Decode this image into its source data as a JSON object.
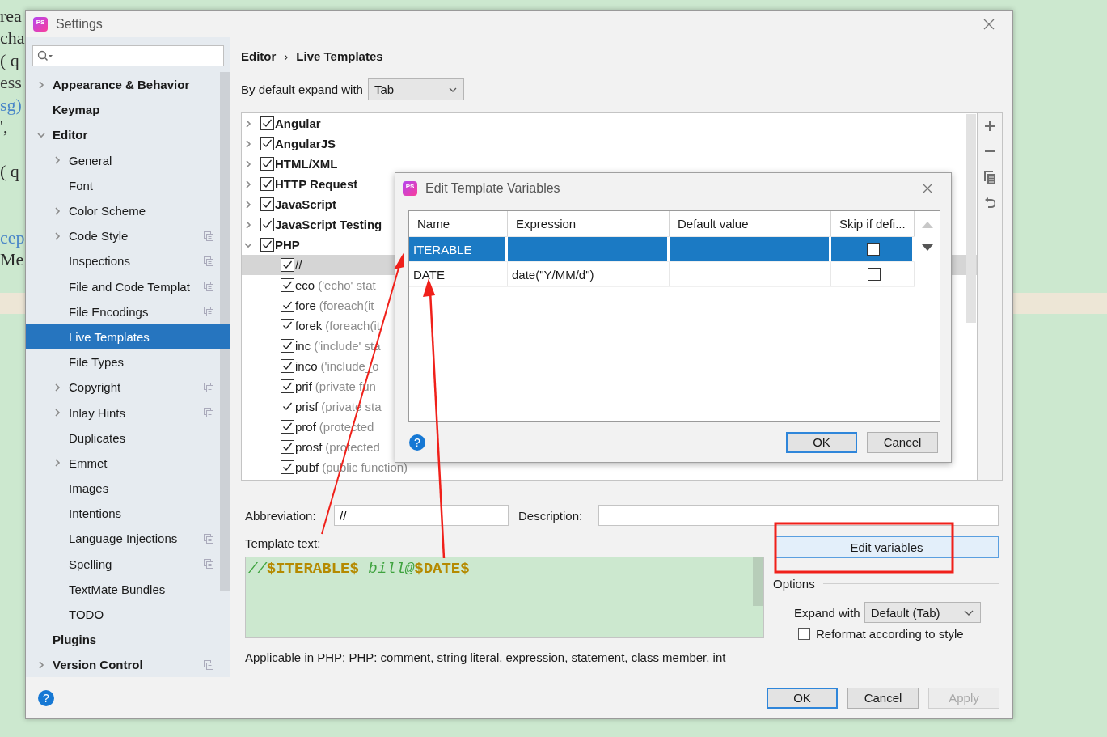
{
  "background_code": [
    {
      "kind": "code",
      "text": "rea",
      "color": "#2b2b2b"
    },
    {
      "kind": "code",
      "text": "cha",
      "color": "#2b2b2b"
    },
    {
      "kind": "code",
      "text": "( q",
      "color": "#2b2b2b"
    },
    {
      "kind": "code",
      "text": "ess",
      "color": "#3c3c3c"
    },
    {
      "kind": "code",
      "text": "sg)",
      "color": "#4a86c8"
    },
    {
      "kind": "code",
      "text": "',",
      "color": "#2b2b2b"
    },
    {
      "kind": "blank"
    },
    {
      "kind": "code",
      "text": "( q",
      "color": "#2b2b2b"
    },
    {
      "kind": "blank"
    },
    {
      "kind": "blank"
    },
    {
      "kind": "code",
      "text": "cep",
      "color": "#4a86c8"
    },
    {
      "kind": "code",
      "text": "Me",
      "color": "#2b2b2b"
    }
  ],
  "window": {
    "logo": "PS",
    "title": "Settings",
    "help": "?"
  },
  "sidebar": {
    "items": [
      {
        "label": "Appearance & Behavior",
        "expanded": false,
        "selected": false,
        "project_level": false
      },
      {
        "label": "Keymap",
        "selected": false,
        "project_level": false
      },
      {
        "label": "Editor",
        "expanded": true,
        "selected": false,
        "project_level": false,
        "children": [
          {
            "label": "General",
            "expanded": false,
            "selected": false,
            "project_level": false
          },
          {
            "label": "Font",
            "selected": false,
            "project_level": false
          },
          {
            "label": "Color Scheme",
            "expanded": false,
            "selected": false,
            "project_level": false
          },
          {
            "label": "Code Style",
            "expanded": false,
            "selected": false,
            "project_level": true
          },
          {
            "label": "Inspections",
            "selected": false,
            "project_level": true
          },
          {
            "label": "File and Code Templat",
            "selected": false,
            "project_level": true
          },
          {
            "label": "File Encodings",
            "selected": false,
            "project_level": true
          },
          {
            "label": "Live Templates",
            "selected": true,
            "project_level": false
          },
          {
            "label": "File Types",
            "selected": false,
            "project_level": false
          },
          {
            "label": "Copyright",
            "expanded": false,
            "selected": false,
            "project_level": true
          },
          {
            "label": "Inlay Hints",
            "expanded": false,
            "selected": false,
            "project_level": true
          },
          {
            "label": "Duplicates",
            "selected": false,
            "project_level": false
          },
          {
            "label": "Emmet",
            "expanded": false,
            "selected": false,
            "project_level": false
          },
          {
            "label": "Images",
            "selected": false,
            "project_level": false
          },
          {
            "label": "Intentions",
            "selected": false,
            "project_level": false
          },
          {
            "label": "Language Injections",
            "selected": false,
            "project_level": true
          },
          {
            "label": "Spelling",
            "selected": false,
            "project_level": true
          },
          {
            "label": "TextMate Bundles",
            "selected": false,
            "project_level": false
          },
          {
            "label": "TODO",
            "selected": false,
            "project_level": false
          }
        ]
      },
      {
        "label": "Plugins",
        "selected": false,
        "project_level": false
      },
      {
        "label": "Version Control",
        "expanded": false,
        "selected": false,
        "project_level": true
      }
    ]
  },
  "breadcrumb": [
    "Editor",
    "›",
    "Live Templates"
  ],
  "expand_default": {
    "label": "By default expand with",
    "value": "Tab"
  },
  "templates": {
    "groups": [
      {
        "label": "Angular",
        "expanded": false,
        "checked": true,
        "selected": false
      },
      {
        "label": "AngularJS",
        "expanded": false,
        "checked": true,
        "selected": false
      },
      {
        "label": "HTML/XML",
        "expanded": false,
        "checked": true,
        "selected": false
      },
      {
        "label": "HTTP Request",
        "expanded": false,
        "checked": true,
        "selected": false
      },
      {
        "label": "JavaScript",
        "expanded": false,
        "checked": true,
        "selected": false
      },
      {
        "label": "JavaScript Testing",
        "expanded": false,
        "checked": true,
        "selected": false
      },
      {
        "label": "PHP",
        "expanded": true,
        "checked": true,
        "selected": false,
        "children": [
          {
            "abbreviation": "//",
            "checked": true,
            "selected": true
          },
          {
            "abbreviation": "eco",
            "description": "('echo' stat",
            "checked": true,
            "selected": false
          },
          {
            "abbreviation": "fore",
            "description": "(foreach(it",
            "checked": true,
            "selected": false
          },
          {
            "abbreviation": "forek",
            "description": "(foreach(it",
            "checked": true,
            "selected": false
          },
          {
            "abbreviation": "inc",
            "description": "('include' sta",
            "checked": true,
            "selected": false
          },
          {
            "abbreviation": "inco",
            "description": "('include_o",
            "checked": true,
            "selected": false
          },
          {
            "abbreviation": "prif",
            "description": "(private fun",
            "checked": true,
            "selected": false
          },
          {
            "abbreviation": "prisf",
            "description": "(private sta",
            "checked": true,
            "selected": false
          },
          {
            "abbreviation": "prof",
            "description": "(protected",
            "checked": true,
            "selected": false
          },
          {
            "abbreviation": "prosf",
            "description": "(protected",
            "checked": true,
            "selected": false
          },
          {
            "abbreviation": "pubf",
            "description": "(public function)",
            "checked": true,
            "selected": false
          }
        ]
      }
    ]
  },
  "editor": {
    "abbreviation_label": "Abbreviation:",
    "abbreviation": "//",
    "description_label": "Description:",
    "template_label": "Template text:",
    "template_text": [
      {
        "kind": "comment",
        "text": "//"
      },
      {
        "kind": "variable",
        "text": "$ITERABLE$"
      },
      {
        "kind": "comment",
        "text": " bill@"
      },
      {
        "kind": "variable",
        "text": "$DATE$"
      }
    ],
    "edit_variables": "Edit variables",
    "options_label": "Options",
    "expand_label": "Expand with",
    "expand_value": "Default (Tab)",
    "reformat": {
      "label": "Reformat according to style",
      "checked": false
    },
    "applicable": "Applicable in PHP; PHP: comment, string literal, expression, statement, class member, int"
  },
  "buttons": [
    {
      "label": "OK",
      "kind": "default",
      "disabled": false
    },
    {
      "label": "Cancel",
      "kind": "normal",
      "disabled": false
    },
    {
      "label": "Apply",
      "kind": "normal",
      "disabled": true
    }
  ],
  "dialog": {
    "logo": "PS",
    "title": "Edit Template Variables",
    "help": "?",
    "columns": [
      "Name",
      "Expression",
      "Default value",
      "Skip if defi..."
    ],
    "rows": [
      {
        "name": "ITERABLE",
        "selected": true,
        "skip_if_defined": false
      },
      {
        "name": "DATE",
        "expression": "date(\"Y/MM/d\")",
        "selected": false,
        "skip_if_defined": false
      }
    ],
    "buttons": [
      {
        "label": "OK",
        "kind": "default"
      },
      {
        "label": "Cancel",
        "kind": "normal"
      }
    ]
  }
}
